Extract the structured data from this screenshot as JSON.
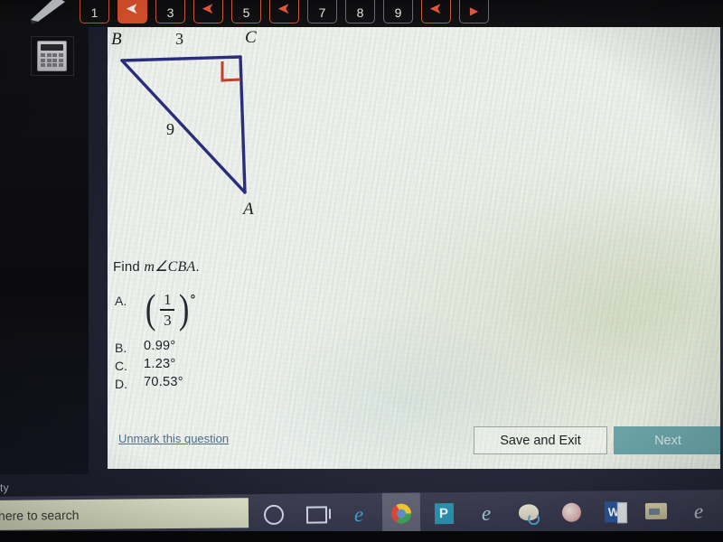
{
  "toolbar": {
    "pen_tool_name": "pen-tool",
    "calculator_tool_name": "calculator",
    "questions": [
      {
        "label": "1",
        "state": "flagged"
      },
      {
        "label": "",
        "state": "current",
        "icon": "flag-icon"
      },
      {
        "label": "3",
        "state": "flagged"
      },
      {
        "label": "",
        "state": "flagged",
        "icon": "flag-icon"
      },
      {
        "label": "5",
        "state": "flagged"
      },
      {
        "label": "",
        "state": "flagged",
        "icon": "flag-icon"
      },
      {
        "label": "7",
        "state": "plain"
      },
      {
        "label": "8",
        "state": "plain"
      },
      {
        "label": "9",
        "state": "plain"
      },
      {
        "label": "",
        "state": "flagged",
        "icon": "flag-icon"
      },
      {
        "label": "",
        "state": "plain",
        "icon": "next-arrow-icon"
      }
    ]
  },
  "figure": {
    "vertex_b": "B",
    "vertex_c": "C",
    "vertex_a": "A",
    "side_bc": "3",
    "side_ba": "9",
    "right_angle_at": "C",
    "line_color": "#2a2d7c",
    "right_angle_color": "#c0412c"
  },
  "question": {
    "prompt_prefix": "Find ",
    "prompt_math": "m∠CBA",
    "prompt_suffix": "."
  },
  "choices": [
    {
      "letter": "A.",
      "type": "fraction",
      "numerator": "1",
      "denominator": "3",
      "degree": "°"
    },
    {
      "letter": "B.",
      "type": "text",
      "text": "0.99°"
    },
    {
      "letter": "C.",
      "type": "text",
      "text": "1.23°"
    },
    {
      "letter": "D.",
      "type": "text",
      "text": "70.53°"
    }
  ],
  "actions": {
    "unmark_link": "Unmark this question",
    "save_and_exit": "Save and Exit",
    "next": "Next",
    "next_color": "#6ba3a8"
  },
  "taskbar": {
    "search_placeholder": "here to search",
    "desktop_text": "ty",
    "icons": [
      {
        "name": "cortana-icon"
      },
      {
        "name": "task-view-icon"
      },
      {
        "name": "edge-icon"
      },
      {
        "name": "chrome-icon"
      },
      {
        "name": "pearson-icon",
        "label": "P"
      },
      {
        "name": "internet-explorer-icon"
      },
      {
        "name": "photos-icon"
      },
      {
        "name": "mail-icon"
      },
      {
        "name": "word-icon",
        "label": "W"
      },
      {
        "name": "file-explorer-icon"
      },
      {
        "name": "ie-legacy-icon"
      }
    ]
  }
}
